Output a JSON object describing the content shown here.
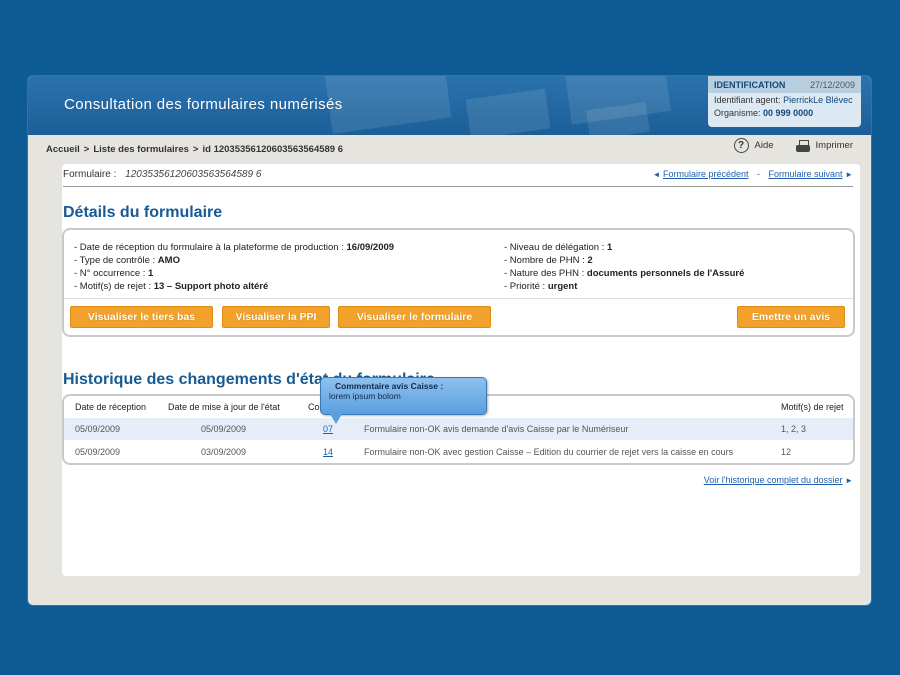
{
  "app": {
    "title": "Consultation des formulaires numérisés"
  },
  "identification": {
    "header": "IDENTIFICATION",
    "date": "27/12/2009",
    "agent_label": "Identifiant agent:",
    "agent_value": "PierrickLe Blévec",
    "org_label": "Organisme:",
    "org_value": "00 999 0000"
  },
  "breadcrumb": {
    "home": "Accueil",
    "sep": ">",
    "list": "Liste des formulaires",
    "current": "id 12035356120603563564589 6"
  },
  "toolbar": {
    "help_label": "Aide",
    "print_label": "Imprimer"
  },
  "form": {
    "label": "Formulaire :",
    "number": "12035356120603563564589 6",
    "prev_link": "Formulaire précédent",
    "next_link": "Formulaire suivant",
    "link_sep": "-"
  },
  "details": {
    "title": "Détails du formulaire",
    "left": [
      {
        "label": "- Date de réception du formulaire à la plateforme de  production  : ",
        "value": "16/09/2009"
      },
      {
        "label": "- Type de contrôle : ",
        "value": "AMO"
      },
      {
        "label": "- N° occurrence  : ",
        "value": "1"
      },
      {
        "label": "- Motif(s) de rejet : ",
        "value": "13 – Support photo altéré"
      }
    ],
    "right": [
      {
        "label": "- Niveau de délégation : ",
        "value": "1"
      },
      {
        "label": "- Nombre de PHN  : ",
        "value": "2"
      },
      {
        "label": "- Nature des PHN  : ",
        "value": "documents personnels de l'Assuré"
      },
      {
        "label": "- Priorité : ",
        "value": "urgent"
      }
    ],
    "buttons": {
      "tiers_bas": "Visualiser le tiers bas",
      "ppi": "Visualiser la PPI",
      "formulaire": "Visualiser le formulaire",
      "avis": "Emettre un avis"
    }
  },
  "history": {
    "title": "Historique des changements d'état du formulaire",
    "columns": {
      "reception": "Date de réception",
      "update": "Date de mise à jour de l'état",
      "code": "Co",
      "motif": "Motif(s) de rejet"
    },
    "rows": [
      {
        "reception": "05/09/2009",
        "update": "05/09/2009",
        "code": "07",
        "libelle": "Formulaire non-OK avis demande d'avis Caisse par le Numériseur",
        "motif": "1, 2, 3"
      },
      {
        "reception": "05/09/2009",
        "update": "03/09/2009",
        "code": "14",
        "libelle": "Formulaire non-OK avec gestion Caisse – Edition du courrier de rejet vers la caisse en cours",
        "motif": "12"
      }
    ],
    "full_link": "Voir l'historique complet du dossier"
  },
  "tooltip": {
    "title": "Commentaire  avis Caisse :",
    "body": "lorem ipsum bolom"
  },
  "colors": {
    "page_bg": "#0d5a95",
    "banner": "#2b72ad",
    "accent_orange": "#f2a12b",
    "title_blue": "#185a94",
    "link_blue": "#1f5fb0"
  }
}
